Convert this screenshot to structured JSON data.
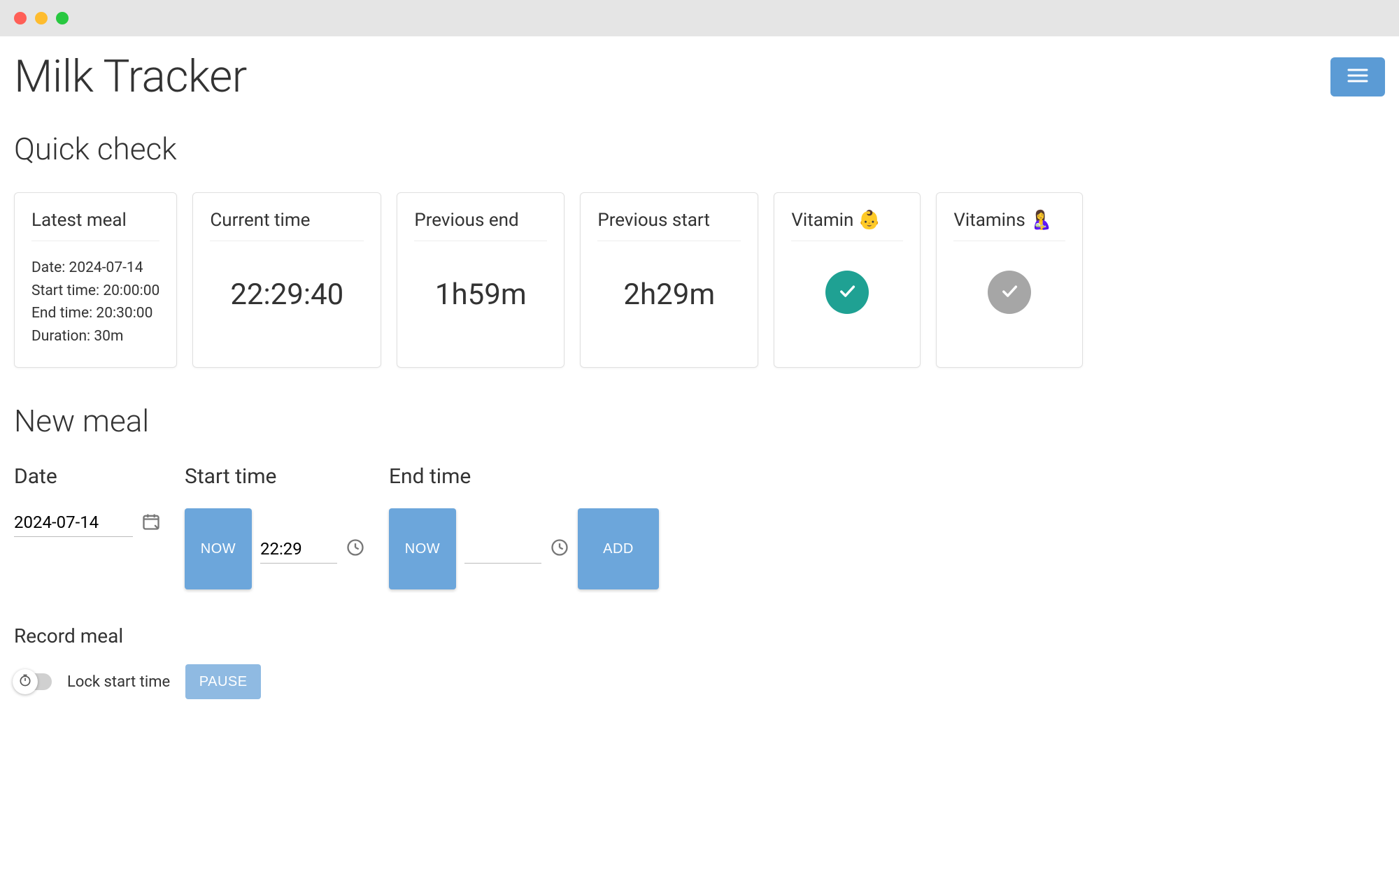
{
  "app_title": "Milk Tracker",
  "sections": {
    "quick_check": "Quick check",
    "new_meal": "New meal",
    "record_meal": "Record meal"
  },
  "cards": {
    "latest_meal": {
      "title": "Latest meal",
      "date_label": "Date:",
      "date_value": "2024-07-14",
      "start_label": "Start time:",
      "start_value": "20:00:00",
      "end_label": "End time:",
      "end_value": "20:30:00",
      "duration_label": "Duration:",
      "duration_value": "30m"
    },
    "current_time": {
      "title": "Current time",
      "value": "22:29:40"
    },
    "previous_end": {
      "title": "Previous end",
      "value": "1h59m"
    },
    "previous_start": {
      "title": "Previous start",
      "value": "2h29m"
    },
    "vitamin_baby": {
      "title": "Vitamin 👶",
      "state": "done"
    },
    "vitamins_mom": {
      "title": "Vitamins 🤱",
      "state": "pending"
    }
  },
  "new_meal": {
    "date_label": "Date",
    "date_value": "2024-07-14",
    "start_label": "Start time",
    "start_value": "22:29",
    "end_label": "End time",
    "end_value": "",
    "now_button": "NOW",
    "add_button": "ADD"
  },
  "record": {
    "lock_label": "Lock start time",
    "pause_button": "PAUSE"
  }
}
